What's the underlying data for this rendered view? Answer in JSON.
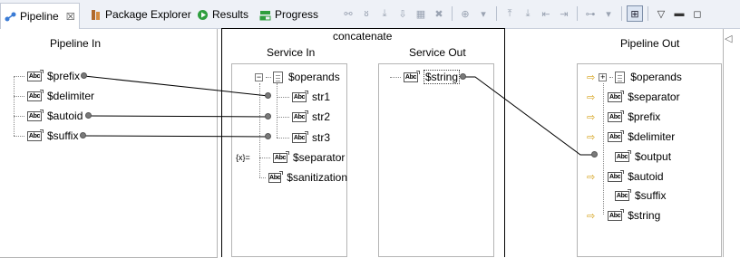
{
  "tabs": {
    "pipeline": "Pipeline",
    "pipeline_close": "☒",
    "package_explorer": "Package Explorer",
    "results": "Results",
    "progress": "Progress"
  },
  "service_title": "concatenate",
  "pipeline_in": {
    "title": "Pipeline In",
    "items": [
      "$prefix",
      "$delimiter",
      "$autoid",
      "$suffix"
    ]
  },
  "service_in": {
    "title": "Service In",
    "root": "$operands",
    "children": [
      "str1",
      "str2",
      "str3"
    ],
    "items": [
      "$separator",
      "$sanitization"
    ],
    "transformer_label": "{x}="
  },
  "service_out": {
    "title": "Service Out",
    "items": [
      "$string"
    ]
  },
  "pipeline_out": {
    "title": "Pipeline Out",
    "items": [
      "$operands",
      "$separator",
      "$prefix",
      "$delimiter",
      "$output",
      "$autoid",
      "$suffix",
      "$string"
    ]
  },
  "type_badge": "Abc",
  "colors": {
    "tabbar": "#eef1f7",
    "link_line": "#000000",
    "arrow_icon": "#d4a017"
  }
}
